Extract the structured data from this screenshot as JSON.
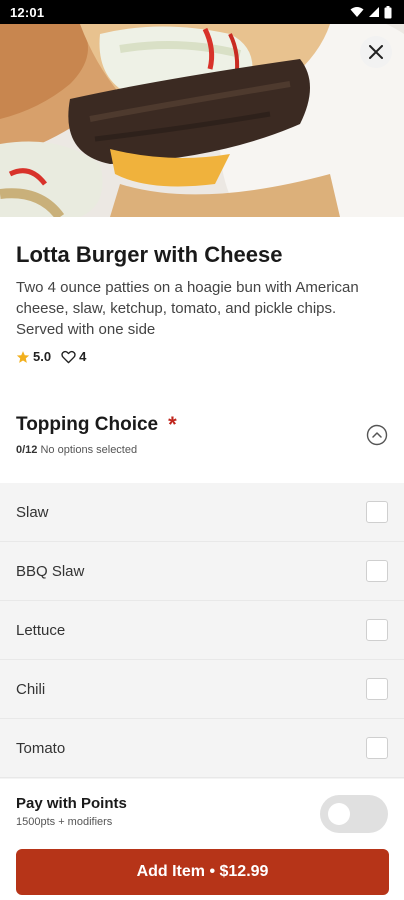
{
  "status_bar": {
    "time": "12:01",
    "icons": [
      "wifi-icon",
      "signal-icon",
      "battery-icon"
    ]
  },
  "hero": {
    "image": "burger-photo",
    "close_icon": "close-icon"
  },
  "item": {
    "title": "Lotta Burger with Cheese",
    "description": "Two 4 ounce patties on a hoagie bun with American cheese, slaw, ketchup, tomato, and pickle chips. Served with one side",
    "rating": "5.0",
    "likes": "4"
  },
  "topping_section": {
    "title": "Topping Choice",
    "required_mark": "*",
    "count": "0/12",
    "status": "No options selected",
    "options": [
      {
        "label": "Slaw",
        "checked": false
      },
      {
        "label": "BBQ Slaw",
        "checked": false
      },
      {
        "label": "Lettuce",
        "checked": false
      },
      {
        "label": "Chili",
        "checked": false
      },
      {
        "label": "Tomato",
        "checked": false
      }
    ]
  },
  "footer": {
    "points_title": "Pay with Points",
    "points_sub": "1500pts + modifiers",
    "points_toggle_on": false,
    "add_button": "Add Item • $12.99"
  },
  "colors": {
    "accent": "#b63418",
    "required": "#c0261d",
    "star": "#f2b01e"
  }
}
